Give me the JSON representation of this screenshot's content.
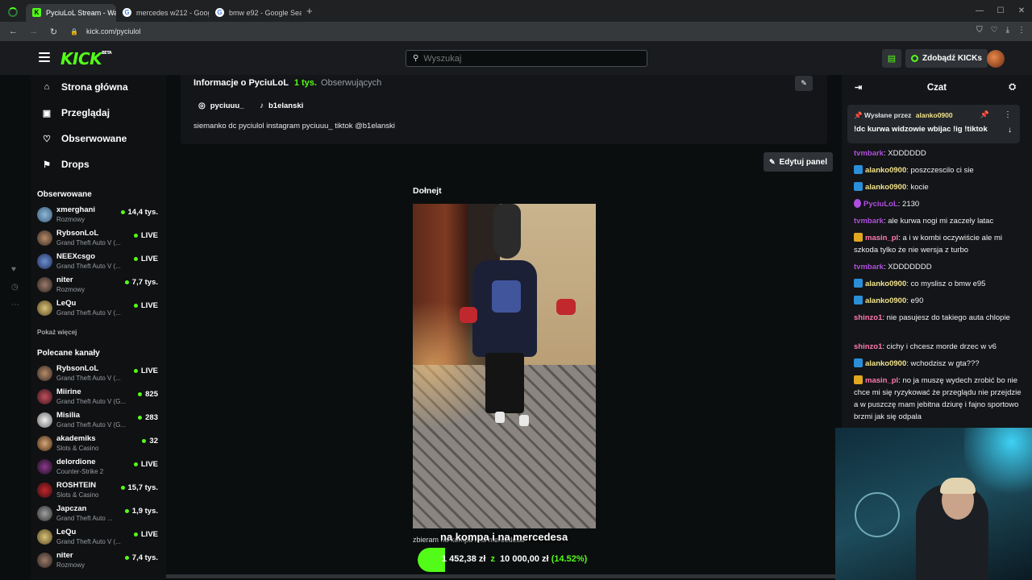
{
  "browser": {
    "tabs": [
      {
        "title": "PyciuLoL Stream - Watc",
        "favicon": "kick"
      },
      {
        "title": "mercedes w212 - Goog",
        "favicon": "google"
      },
      {
        "title": "bmw e92 - Google Sea",
        "favicon": "google"
      }
    ],
    "new_tab": "+",
    "url": "kick.com/pyciulol"
  },
  "header": {
    "logo": "KICK",
    "logo_badge": "BETA",
    "search_placeholder": "Wyszukaj",
    "kicks_button": "Zdobądź KICKs"
  },
  "nav": [
    {
      "label": "Strona główna",
      "icon": "home-icon"
    },
    {
      "label": "Przeglądaj",
      "icon": "browse-icon"
    },
    {
      "label": "Obserwowane",
      "icon": "heart-icon"
    },
    {
      "label": "Drops",
      "icon": "drops-icon"
    }
  ],
  "followed": {
    "title": "Obserwowane",
    "channels": [
      {
        "name": "xmerghani",
        "category": "Rozmowy",
        "viewers": "14,4 tys."
      },
      {
        "name": "RybsonLoL",
        "category": "Grand Theft Auto V (...",
        "viewers": "LIVE"
      },
      {
        "name": "NEEXcsgo",
        "category": "Grand Theft Auto V (...",
        "viewers": "LIVE"
      },
      {
        "name": "niter",
        "category": "Rozmowy",
        "viewers": "7,7 tys."
      },
      {
        "name": "LeQu",
        "category": "Grand Theft Auto V (...",
        "viewers": "LIVE"
      }
    ],
    "show_more": "Pokaż więcej"
  },
  "recommended": {
    "title": "Polecane kanały",
    "channels": [
      {
        "name": "RybsonLoL",
        "category": "Grand Theft Auto V (...",
        "viewers": "LIVE"
      },
      {
        "name": "Miirine",
        "category": "Grand Theft Auto V (G...",
        "viewers": "825"
      },
      {
        "name": "Misilia",
        "category": "Grand Theft Auto V (G...",
        "viewers": "283"
      },
      {
        "name": "akademiks",
        "category": "Slots & Casino",
        "viewers": "32"
      },
      {
        "name": "delordione",
        "category": "Counter-Strike 2",
        "viewers": "LIVE"
      },
      {
        "name": "ROSHTEIN",
        "category": "Slots & Casino",
        "viewers": "15,7 tys."
      },
      {
        "name": "Japczan",
        "category": "Grand Theft Auto ...",
        "viewers": "1,9 tys."
      },
      {
        "name": "LeQu",
        "category": "Grand Theft Auto V (...",
        "viewers": "LIVE"
      },
      {
        "name": "niter",
        "category": "Rozmowy",
        "viewers": "7,4 tys."
      }
    ]
  },
  "about": {
    "title": "Informacje o PyciuLoL",
    "followers": "1 tys.",
    "followers_label": "Obserwujących",
    "instagram": "pyciuuu_",
    "tiktok": "b1elanski",
    "bio": "siemanko dc pyciulol instagram pyciuuu_ tiktok @b1elanski",
    "edit_panel": "Edytuj panel"
  },
  "donate": {
    "title": "Dołnejt",
    "caption_small": "zbieram na kompa i na mercedesa",
    "caption_overlay": "na kompa i na mercedesa",
    "current": "1 452,38 zł",
    "connector": "z",
    "goal": "10 000,00 zł",
    "percent": "(14.52%)",
    "progress": 0.1452
  },
  "chat": {
    "title": "Czat",
    "pinned_by_label": "Wysłane przez",
    "pinned_user": "alanko0900",
    "pinned_message": "!dc kurwa widzowie wbijac !ig !tiktok",
    "messages": [
      {
        "user": "tvmbark",
        "color": "#b04ee0",
        "badge": "",
        "text": "XDDDDDD"
      },
      {
        "user": "alanko0900",
        "color": "#f3e38a",
        "badge": "blue",
        "text": "poszczescilo ci sie"
      },
      {
        "user": "alanko0900",
        "color": "#f3e38a",
        "badge": "blue",
        "text": "kocie"
      },
      {
        "user": "PyciuLoL",
        "color": "#b04ee0",
        "badge": "purple",
        "text": "2130"
      },
      {
        "user": "tvmbark",
        "color": "#b04ee0",
        "badge": "",
        "text": "ale kurwa nogi mi zaczely latac"
      },
      {
        "user": "masin_pl",
        "color": "#ff79b0",
        "badge": "gold",
        "text": "a i w kombi oczywiście ale mi szkoda tylko że nie wersja z turbo"
      },
      {
        "user": "tvmbark",
        "color": "#b04ee0",
        "badge": "",
        "text": "XDDDDDDD"
      },
      {
        "user": "alanko0900",
        "color": "#f3e38a",
        "badge": "blue",
        "text": "co myslisz o bmw e95"
      },
      {
        "user": "alanko0900",
        "color": "#f3e38a",
        "badge": "blue",
        "text": "e90"
      },
      {
        "user": "shinzo1",
        "color": "#ff79b0",
        "badge": "",
        "text": "nie pasujesz do takiego auta chlopie"
      },
      {
        "user": "shinzo1",
        "color": "#ff79b0",
        "badge": "",
        "text": "cichy i chcesz morde drzec w v6"
      },
      {
        "user": "alanko0900",
        "color": "#f3e38a",
        "badge": "blue",
        "text": "wchodzisz w gta???"
      },
      {
        "user": "masin_pl",
        "color": "#ff79b0",
        "badge": "gold",
        "text": "no ja muszę wydech zrobić bo nie chce mi się ryzykować że przeglądu nie przejdzie a w puszczę mam jebitna dziurę i fajno sportowo brzmi jak się odpala"
      }
    ]
  },
  "colors": {
    "accent": "#53fc18"
  }
}
